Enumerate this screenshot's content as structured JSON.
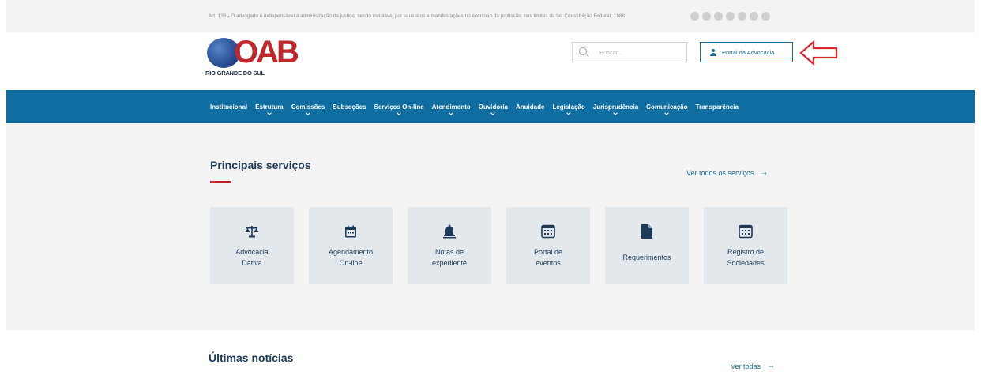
{
  "topbar": {
    "quote": "Art. 133 - O advogado é indispensável à administração da justiça, sendo inviolável por seus atos e manifestações no exercício da profissão, nos limites da lei. Constituição Federal, 1988",
    "social_icons": [
      "facebook-icon",
      "twitter-icon",
      "instagram-icon",
      "youtube-icon",
      "linkedin-icon",
      "flickr-icon",
      "spotify-icon"
    ]
  },
  "header": {
    "logo_text": "OAB",
    "logo_subtitle": "RIO GRANDE DO SUL",
    "search_placeholder": "Buscar...",
    "portal_button": "Portal da Advocacia",
    "annotation_color": "#d8262b"
  },
  "nav": {
    "items": [
      {
        "label": "Institucional",
        "dropdown": false
      },
      {
        "label": "Estrutura",
        "dropdown": true
      },
      {
        "label": "Comissões",
        "dropdown": true
      },
      {
        "label": "Subseções",
        "dropdown": false
      },
      {
        "label": "Serviços On-line",
        "dropdown": true
      },
      {
        "label": "Atendimento",
        "dropdown": true
      },
      {
        "label": "Ouvidoria",
        "dropdown": true
      },
      {
        "label": "Anuidade",
        "dropdown": false
      },
      {
        "label": "Legislação",
        "dropdown": true
      },
      {
        "label": "Jurisprudência",
        "dropdown": true
      },
      {
        "label": "Comunicação",
        "dropdown": true
      },
      {
        "label": "Transparência",
        "dropdown": false
      }
    ]
  },
  "services": {
    "title": "Principais serviços",
    "see_all": "Ver todos os serviços",
    "cards": [
      {
        "label": "Advocacia\nDativa",
        "icon": "scales-icon"
      },
      {
        "label": "Agendamento\nOn-line",
        "icon": "calendar-icon"
      },
      {
        "label": "Notas de\nexpediente",
        "icon": "bell-icon"
      },
      {
        "label": "Portal de\neventos",
        "icon": "calendar-grid-icon"
      },
      {
        "label": "Requerimentos",
        "icon": "document-icon"
      },
      {
        "label": "Registro de\nSociedades",
        "icon": "calendar-grid-icon"
      }
    ]
  },
  "news": {
    "title": "Últimas notícias",
    "see_all": "Ver todas"
  },
  "colors": {
    "nav_bg": "#0f6da1",
    "accent_red": "#c0272d",
    "link_blue": "#1a6e9c",
    "card_bg": "#e2e8ec",
    "section_bg": "#f3f3f3"
  }
}
